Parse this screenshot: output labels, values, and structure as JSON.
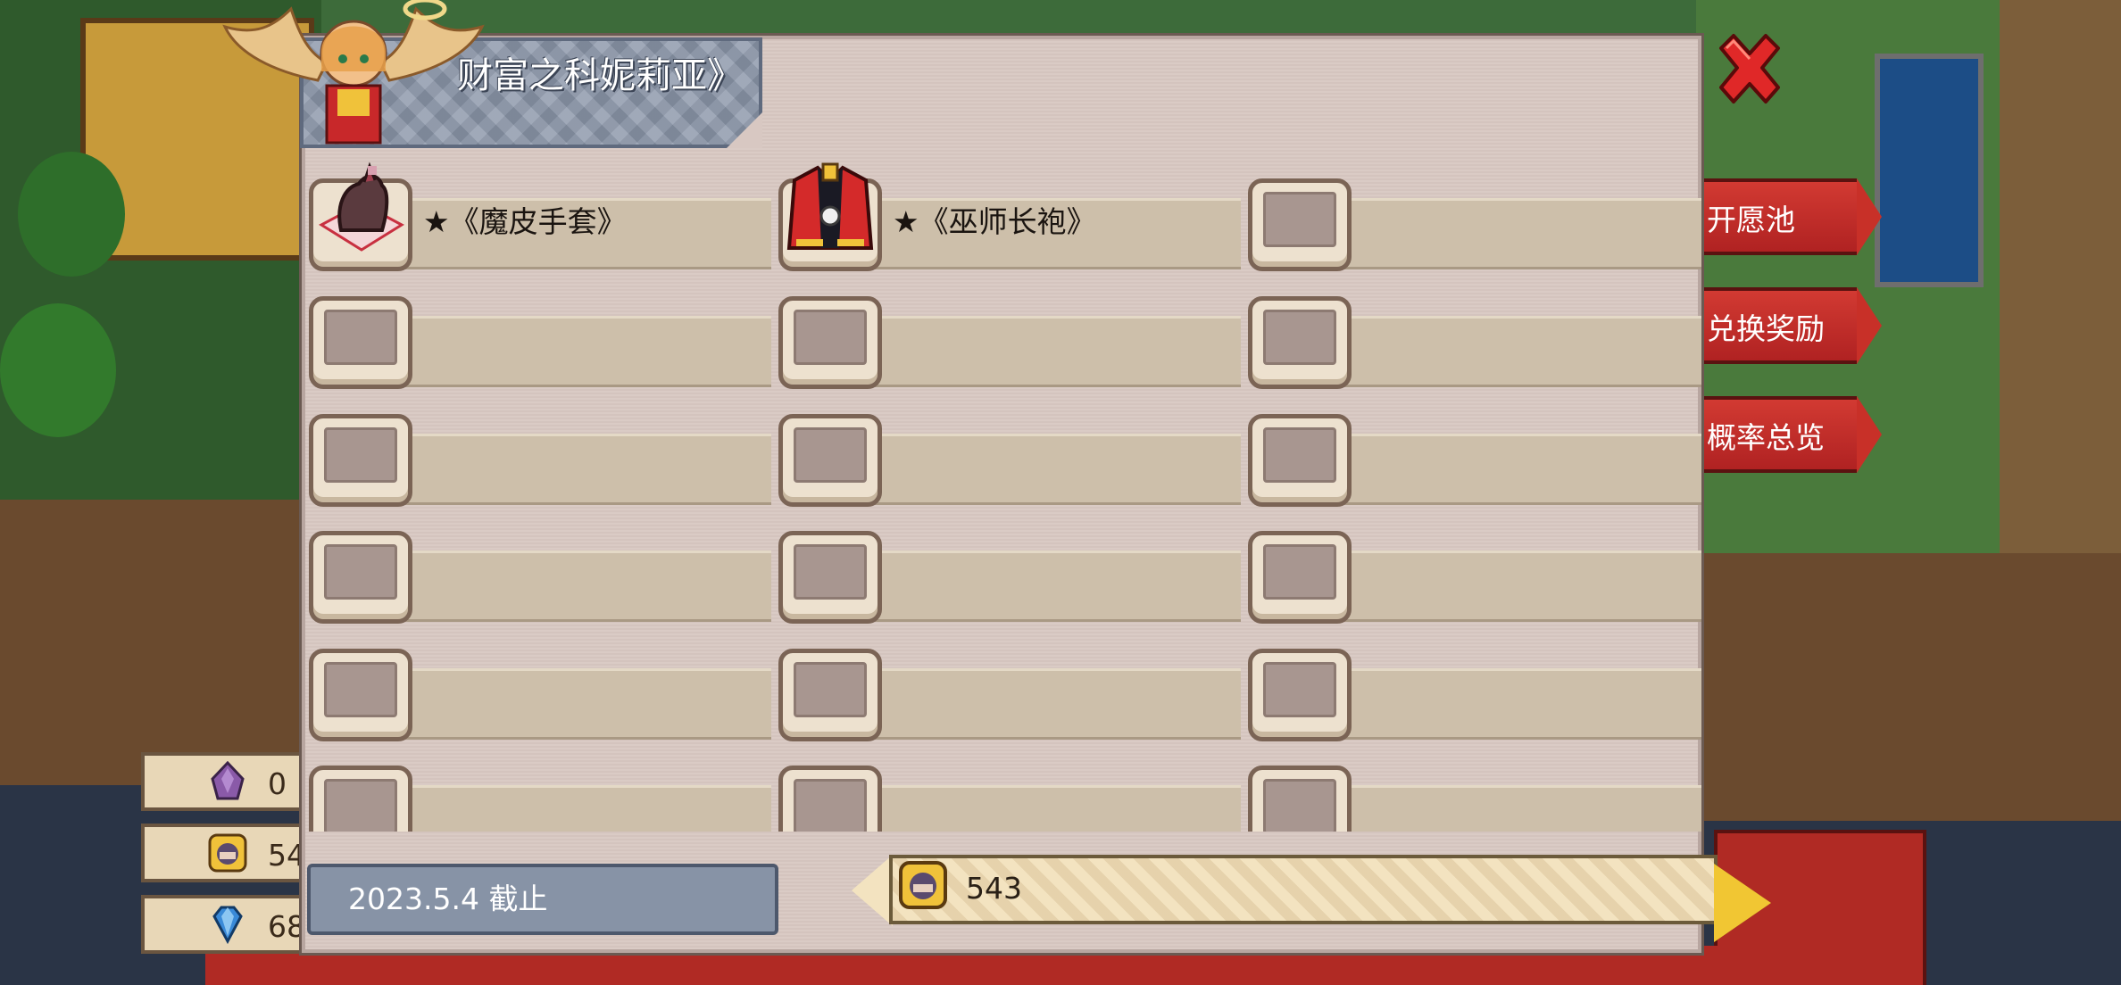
{
  "title": "财富之科妮莉亚》",
  "side_menu": [
    "开愿池",
    "兑换奖励",
    "概率总览"
  ],
  "resources": [
    {
      "icon": "purple-crystal-icon",
      "value": "0"
    },
    {
      "icon": "character-token-icon",
      "value": "54"
    },
    {
      "icon": "blue-diamond-icon",
      "value": "68"
    }
  ],
  "items": [
    {
      "label": "★《魔皮手套》",
      "icon": "demon-glove-icon"
    },
    {
      "label": "★《巫师长袍》",
      "icon": "wizard-robe-icon"
    },
    {
      "label": "",
      "icon": ""
    }
  ],
  "deadline": "2023.5.4 截止",
  "coin_count": "543",
  "colors": {
    "panel": "#d8c8c2",
    "banner": "#8c97aa",
    "side_button": "#c83028",
    "coin_bar": "#f3e3c0",
    "close": "#e02828"
  }
}
